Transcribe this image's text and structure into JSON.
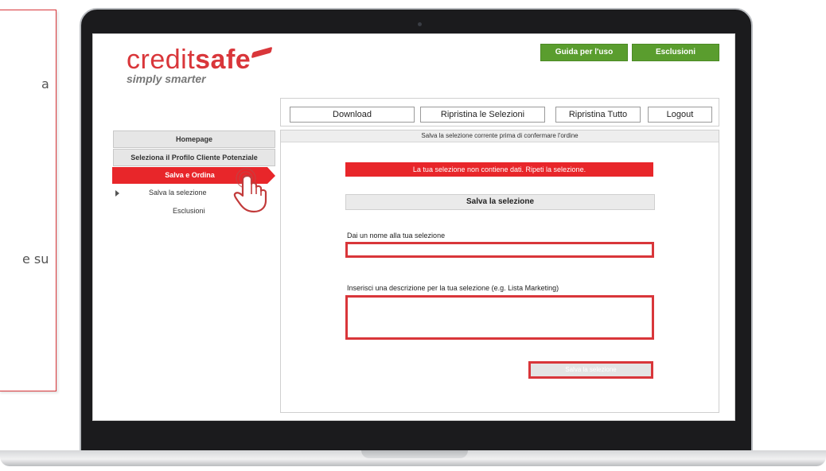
{
  "callout": {
    "fragment_1": "a",
    "fragment_2": "e su"
  },
  "app": {
    "logo": {
      "brand_part1": "credit",
      "brand_part2": "safe",
      "tagline": "simply smarter"
    },
    "top_buttons": [
      "Guida per l'uso",
      "Esclusioni"
    ],
    "nav_buttons": [
      "Download",
      "Ripristina le Selezioni",
      "Ripristina Tutto",
      "Logout"
    ],
    "sidebar": {
      "homepage": "Homepage",
      "profile": "Seleziona il Profilo Cliente Potenziale",
      "active": "Salva e Ordina",
      "sub_items": [
        "Salva la selezione",
        "Esclusioni"
      ]
    },
    "main": {
      "header": "Salva la selezione corrente prima di confermare l'ordine",
      "error": "La tua selezione non contiene dati. Ripeti la selezione.",
      "section_title": "Salva la selezione",
      "name_label": "Dai un nome alla tua selezione",
      "name_value": "",
      "description_label": "Inserisci una descrizione per la tua selezione (e.g. Lista Marketing)",
      "description_value": "",
      "save_button": "Salva la selezione"
    }
  },
  "colors": {
    "brand_red": "#d9363a",
    "active_red": "#e8262a",
    "green": "#5a9d2e"
  }
}
